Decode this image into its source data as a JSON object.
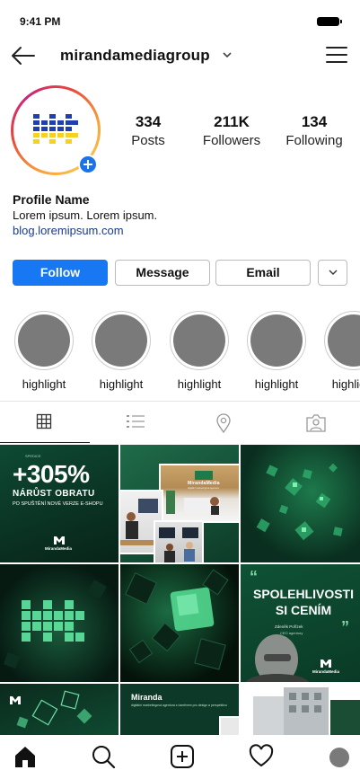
{
  "status_bar": {
    "time": "9:41 PM"
  },
  "header": {
    "username": "mirandamediagroup"
  },
  "profile": {
    "logo_colors": [
      "#1f3fb0",
      "#f7d21c"
    ],
    "add_story_color": "#1a73e8",
    "stats": [
      {
        "value": "334",
        "label": "Posts"
      },
      {
        "value": "211K",
        "label": "Followers"
      },
      {
        "value": "134",
        "label": "Following"
      }
    ],
    "name": "Profile Name",
    "bio": "Lorem ipsum. Lorem ipsum.",
    "link": "blog.loremipsum.com"
  },
  "actions": {
    "follow": "Follow",
    "message": "Message",
    "email": "Email",
    "accent": "#1877f2"
  },
  "highlights": [
    {
      "label": "highlight"
    },
    {
      "label": "highlight"
    },
    {
      "label": "highlight"
    },
    {
      "label": "highlight"
    },
    {
      "label": "highlight"
    }
  ],
  "tabs": [
    {
      "icon": "grid-icon",
      "active": true
    },
    {
      "icon": "list-icon",
      "active": false
    },
    {
      "icon": "location-pin-icon",
      "active": false
    },
    {
      "icon": "tagged-person-icon",
      "active": false
    }
  ],
  "posts": {
    "post1": {
      "badge": "SPEDICE",
      "headline": "+305%",
      "subhead": "NÁRŮST OBRATU",
      "caption": "PO SPUŠTĚNÍ NOVÉ VERZE E-SHOPU",
      "brand": "MirandaMedia"
    },
    "post2": {
      "sign": "MirandaMedia",
      "sign_sub": "digitální marketingová agentura"
    },
    "post6": {
      "title": "SPOLEHLIVOSTI SI CENÍM",
      "quote_name": "Zdeněk Pořízek",
      "quote_role": "CEO agentury",
      "brand": "MirandaMedia"
    },
    "post8": {
      "title": "Miranda",
      "text": "digitální marketingová agentura s úsměvem pro design a perspektivu"
    }
  },
  "bottom_nav": [
    {
      "icon": "home-icon"
    },
    {
      "icon": "search-icon"
    },
    {
      "icon": "new-post-icon"
    },
    {
      "icon": "heart-icon"
    },
    {
      "icon": "profile-avatar-icon"
    }
  ]
}
